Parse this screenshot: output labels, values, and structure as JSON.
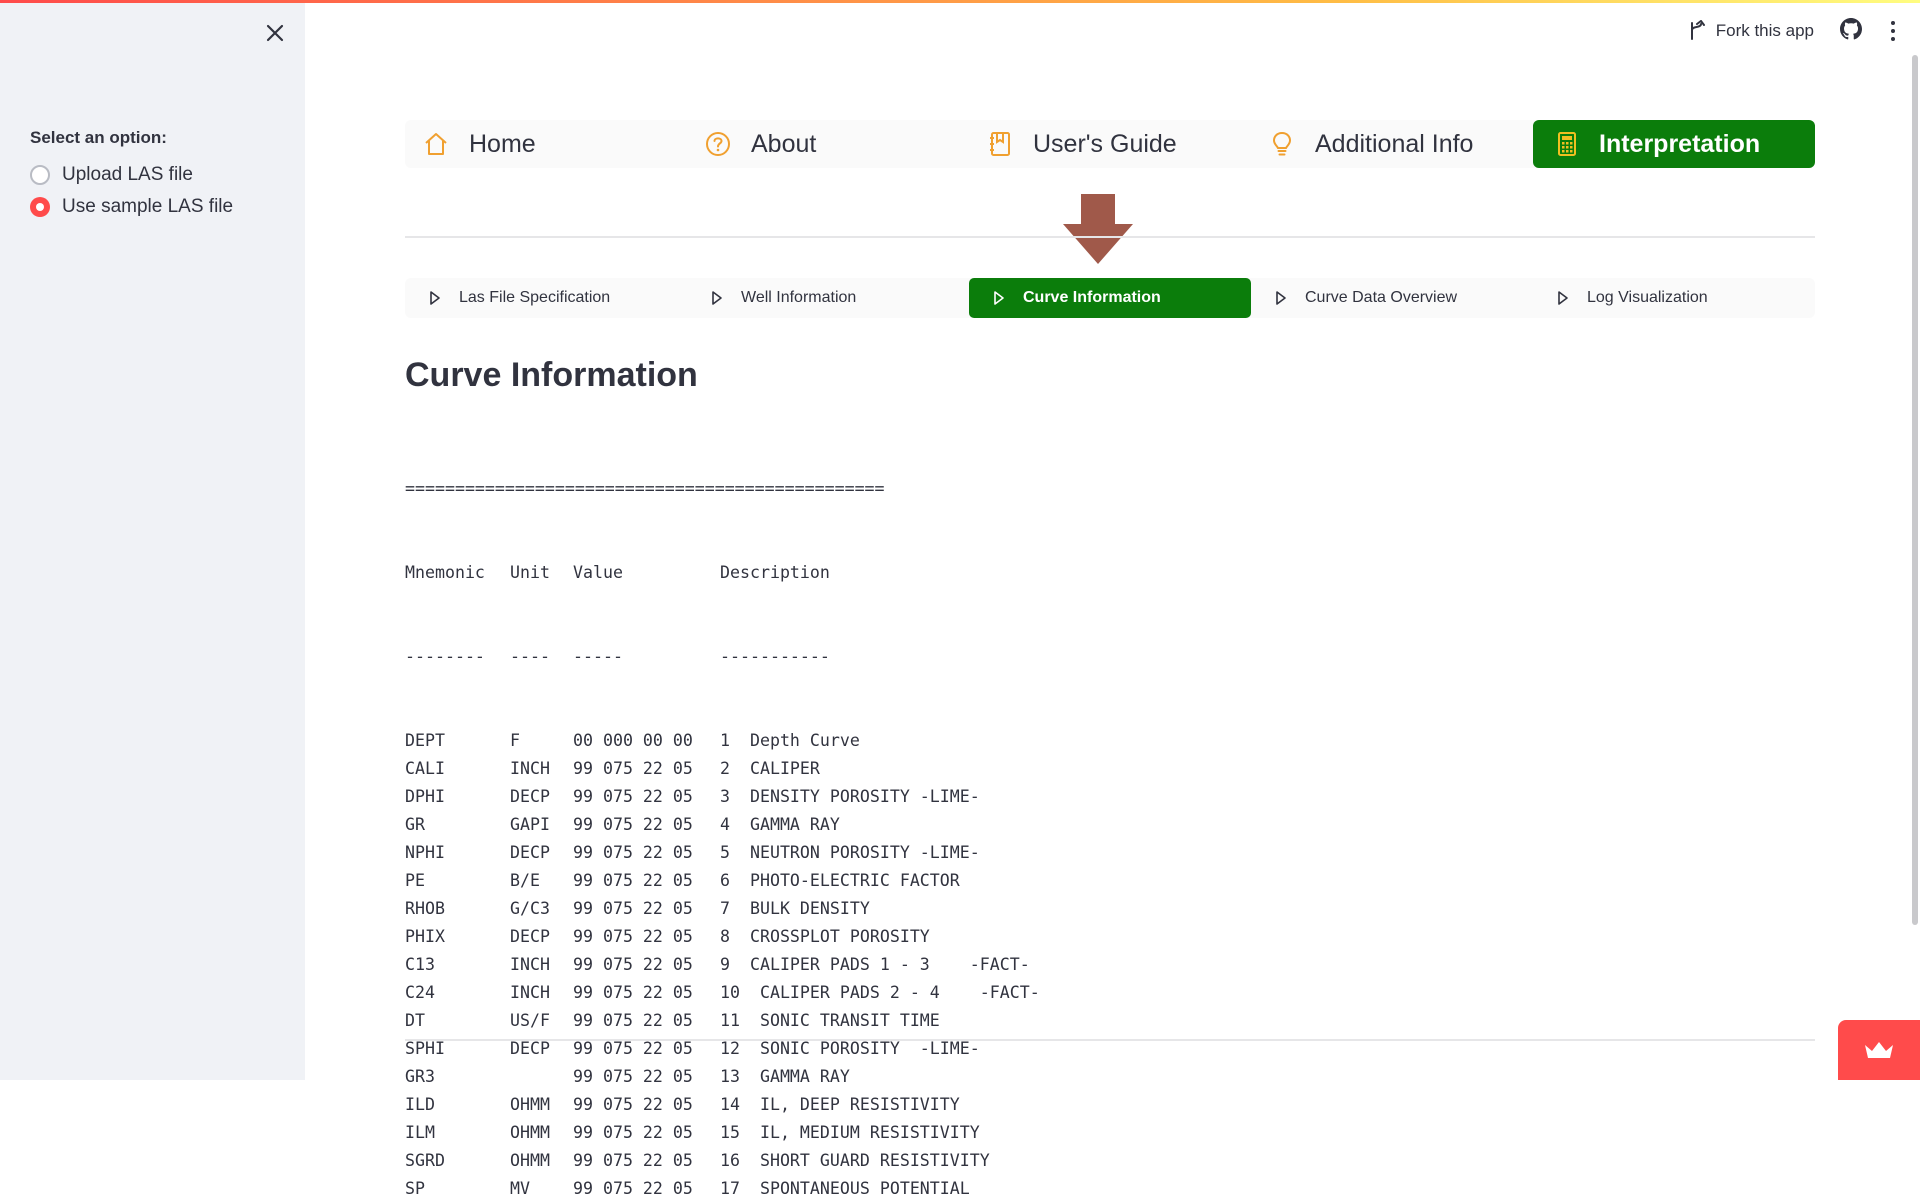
{
  "sidebar": {
    "label": "Select an option:",
    "options": [
      {
        "label": "Upload LAS file",
        "selected": false
      },
      {
        "label": "Use sample LAS file",
        "selected": true
      }
    ]
  },
  "header": {
    "fork_label": "Fork this app"
  },
  "nav": {
    "items": [
      {
        "label": "Home",
        "icon": "house-icon"
      },
      {
        "label": "About",
        "icon": "question-circle-icon"
      },
      {
        "label": "User's Guide",
        "icon": "journal-bookmark-icon"
      },
      {
        "label": "Additional Info",
        "icon": "lightbulb-icon"
      },
      {
        "label": "Interpretation",
        "icon": "calculator-icon",
        "active": true
      }
    ]
  },
  "subnav": {
    "items": [
      {
        "label": "Las File Specification"
      },
      {
        "label": "Well Information"
      },
      {
        "label": "Curve Information",
        "active": true
      },
      {
        "label": "Curve Data Overview"
      },
      {
        "label": "Log Visualization"
      }
    ]
  },
  "page_title": "Curve Information",
  "curve_table": {
    "separator": "================================================",
    "headers": {
      "mnemonic": "Mnemonic",
      "unit": "Unit",
      "value": "Value",
      "description": "Description"
    },
    "dashes": {
      "mnemonic": "--------",
      "unit": "----",
      "value": "-----",
      "description": "-----------"
    },
    "rows": [
      {
        "mnemonic": "DEPT",
        "unit": "F",
        "value": "00 000 00 00",
        "description": "1  Depth Curve"
      },
      {
        "mnemonic": "CALI",
        "unit": "INCH",
        "value": "99 075 22 05",
        "description": "2  CALIPER"
      },
      {
        "mnemonic": "DPHI",
        "unit": "DECP",
        "value": "99 075 22 05",
        "description": "3  DENSITY POROSITY -LIME-"
      },
      {
        "mnemonic": "GR",
        "unit": "GAPI",
        "value": "99 075 22 05",
        "description": "4  GAMMA RAY"
      },
      {
        "mnemonic": "NPHI",
        "unit": "DECP",
        "value": "99 075 22 05",
        "description": "5  NEUTRON POROSITY -LIME-"
      },
      {
        "mnemonic": "PE",
        "unit": "B/E",
        "value": "99 075 22 05",
        "description": "6  PHOTO-ELECTRIC FACTOR"
      },
      {
        "mnemonic": "RHOB",
        "unit": "G/C3",
        "value": "99 075 22 05",
        "description": "7  BULK DENSITY"
      },
      {
        "mnemonic": "PHIX",
        "unit": "DECP",
        "value": "99 075 22 05",
        "description": "8  CROSSPLOT POROSITY"
      },
      {
        "mnemonic": "C13",
        "unit": "INCH",
        "value": "99 075 22 05",
        "description": "9  CALIPER PADS 1 - 3    -FACT-"
      },
      {
        "mnemonic": "C24",
        "unit": "INCH",
        "value": "99 075 22 05",
        "description": "10  CALIPER PADS 2 - 4    -FACT-"
      },
      {
        "mnemonic": "DT",
        "unit": "US/F",
        "value": "99 075 22 05",
        "description": "11  SONIC TRANSIT TIME"
      },
      {
        "mnemonic": "SPHI",
        "unit": "DECP",
        "value": "99 075 22 05",
        "description": "12  SONIC POROSITY  -LIME-"
      },
      {
        "mnemonic": "GR3",
        "unit": "",
        "value": "99 075 22 05",
        "description": "13  GAMMA RAY"
      },
      {
        "mnemonic": "ILD",
        "unit": "OHMM",
        "value": "99 075 22 05",
        "description": "14  IL, DEEP RESISTIVITY"
      },
      {
        "mnemonic": "ILM",
        "unit": "OHMM",
        "value": "99 075 22 05",
        "description": "15  IL, MEDIUM RESISTIVITY"
      },
      {
        "mnemonic": "SGRD",
        "unit": "OHMM",
        "value": "99 075 22 05",
        "description": "16  SHORT GUARD RESISTIVITY"
      },
      {
        "mnemonic": "SP",
        "unit": "MV",
        "value": "99 075 22 05",
        "description": "17  SPONTANEOUS POTENTIAL"
      }
    ]
  },
  "colors": {
    "active_green": "#0b7d0b",
    "arrow_brown": "#a0594a",
    "radio_red": "#ff4b4b",
    "sidebar_bg": "#f0f2f6"
  }
}
